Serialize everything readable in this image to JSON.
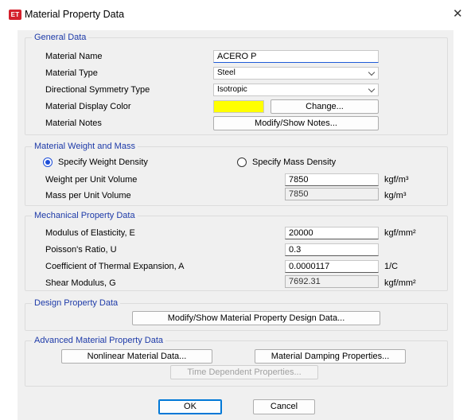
{
  "window": {
    "icon_text": "ET",
    "title": "Material Property Data",
    "close_glyph": "✕"
  },
  "general": {
    "title": "General Data",
    "material_name_label": "Material Name",
    "material_name_value": "ACERO P",
    "material_type_label": "Material Type",
    "material_type_value": "Steel",
    "symmetry_label": "Directional Symmetry Type",
    "symmetry_value": "Isotropic",
    "display_color_label": "Material Display Color",
    "display_color": "#ffff00",
    "change_button": "Change...",
    "notes_label": "Material Notes",
    "notes_button": "Modify/Show Notes..."
  },
  "weight": {
    "title": "Material Weight and Mass",
    "radio_weight": "Specify Weight Density",
    "radio_mass": "Specify Mass Density",
    "selected": "weight",
    "weight_label": "Weight per Unit Volume",
    "weight_value": "7850",
    "weight_unit": "kgf/m³",
    "mass_label": "Mass per Unit Volume",
    "mass_value": "7850",
    "mass_unit": "kg/m³"
  },
  "mechanical": {
    "title": "Mechanical Property Data",
    "e_label": "Modulus of Elasticity,  E",
    "e_value": "20000",
    "e_unit": "kgf/mm²",
    "u_label": "Poisson's Ratio,  U",
    "u_value": "0.3",
    "a_label": "Coefficient of Thermal Expansion,  A",
    "a_value": "0.0000117",
    "a_unit": "1/C",
    "g_label": "Shear Modulus,  G",
    "g_value": "7692.31",
    "g_unit": "kgf/mm²"
  },
  "design": {
    "title": "Design Property Data",
    "button": "Modify/Show Material Property Design Data..."
  },
  "advanced": {
    "title": "Advanced Material Property Data",
    "nonlinear_button": "Nonlinear Material Data...",
    "damping_button": "Material Damping Properties...",
    "time_button": "Time Dependent Properties..."
  },
  "footer": {
    "ok": "OK",
    "cancel": "Cancel"
  },
  "colors": {
    "group_title": "#1d3aa8",
    "accent": "#0078d7",
    "app_icon": "#d4202c"
  }
}
